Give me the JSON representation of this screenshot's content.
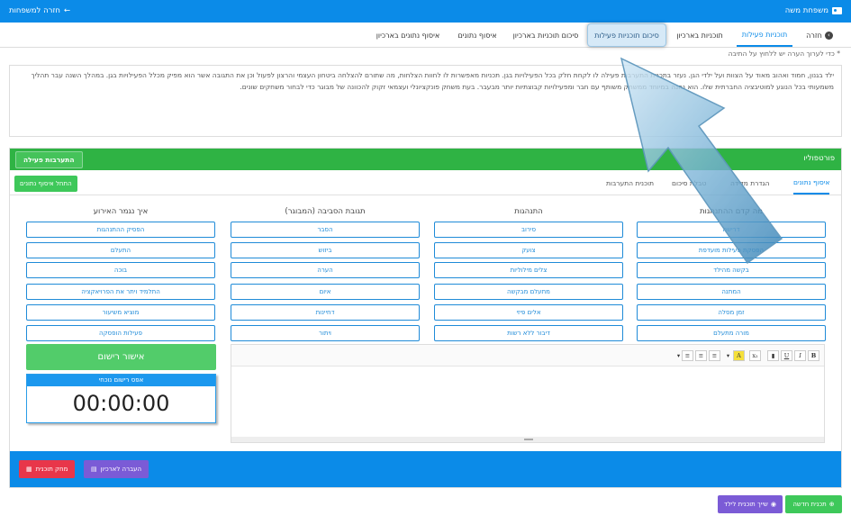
{
  "topbar": {
    "user_name": "משפחת משה",
    "back_label": "חזרה למשפחות"
  },
  "nav": {
    "back_label": "חזרה",
    "tabs": [
      "תוכניות פעילות",
      "תוכניות בארכיון",
      "סיכום תוכניות פעילות",
      "סיכום תוכניות בארכיון",
      "איסוף נתונים",
      "איסוף נתונים בארכיון"
    ]
  },
  "note": "* כדי לערוך הערה יש ללחוץ על התיבה",
  "description": "ילד בגנון, חמוד ואהוב מאוד על הצוות ועל ילדי הגן. נעזר בתכנית התערבות פעילה לו לקחת חלק בכל הפעילויות בגן. תכניות מאפשרות לו לחוות הצלחות, מה שתורם להצלחה ביטחון העצמי והרצון לפעול וכן את התגובה אשר הוא מפיק מכלל הפעילויות בגן. במהלך השנה עבר תהליך משמעותי בכל הנוגע למוטיבציה החברתית שלו. הוא נהנה במיוחד ממשחק משותף עם חבר ומפעילויות קבוצתיות יותר מבעבר. בעת משחק פונקציונלי ועצמאי זקוק להכוונה של מבוגר כדי לבחור משחקים שונים.",
  "portfolio": {
    "title": "פורטפוליו",
    "active_button": "התערבות פעילה",
    "subtabs": [
      "איסוף נתונים",
      "הגדרת מדידה",
      "טבלת סיכום",
      "תוכנית התערבות"
    ],
    "start_button": "התחל איסוף נתונים",
    "columns": [
      {
        "header": "מה קדם ההתנהגות",
        "options": [
          "דרישה",
          "הפסקת פעילות מועדפת",
          "בקשה מהילד",
          "המתנה",
          "זמן מסלה",
          "מורה מתעלם"
        ]
      },
      {
        "header": "התנהגות",
        "options": [
          "סירוב",
          "צועק",
          "צלים מילוליות",
          "מתעלם מבקשה",
          "אלים פיזי",
          "דיבור ללא רשות"
        ]
      },
      {
        "header": "תגובת הסביבה (המבוגר)",
        "options": [
          "הסבר",
          "ביזוש",
          "הערה",
          "איום",
          "דחיינות",
          "ויתור"
        ]
      },
      {
        "header": "איך נגמר האירוע",
        "options": [
          "הפסיק ההתנהגות",
          "התעלם",
          "בוכה",
          "התלמיד ויתר את הפרויאקציה",
          "מוציא משיעור",
          "פעילות הופסקה"
        ]
      }
    ],
    "confirm_button": "אישור רישום",
    "timer_label": "אפס רישום נוכחי",
    "timer_value": "00:00:00",
    "delete_button": "מחק תוכנית",
    "archive_button": "העברה לארכיון"
  },
  "footer": {
    "new_plan": "תכנית חדשה",
    "assign_plan": "שייך תוכנית לילד"
  },
  "colors": {
    "primary": "#0b8be8",
    "green": "#2fb344",
    "danger": "#e8364a",
    "purple": "#7b5bd6"
  }
}
